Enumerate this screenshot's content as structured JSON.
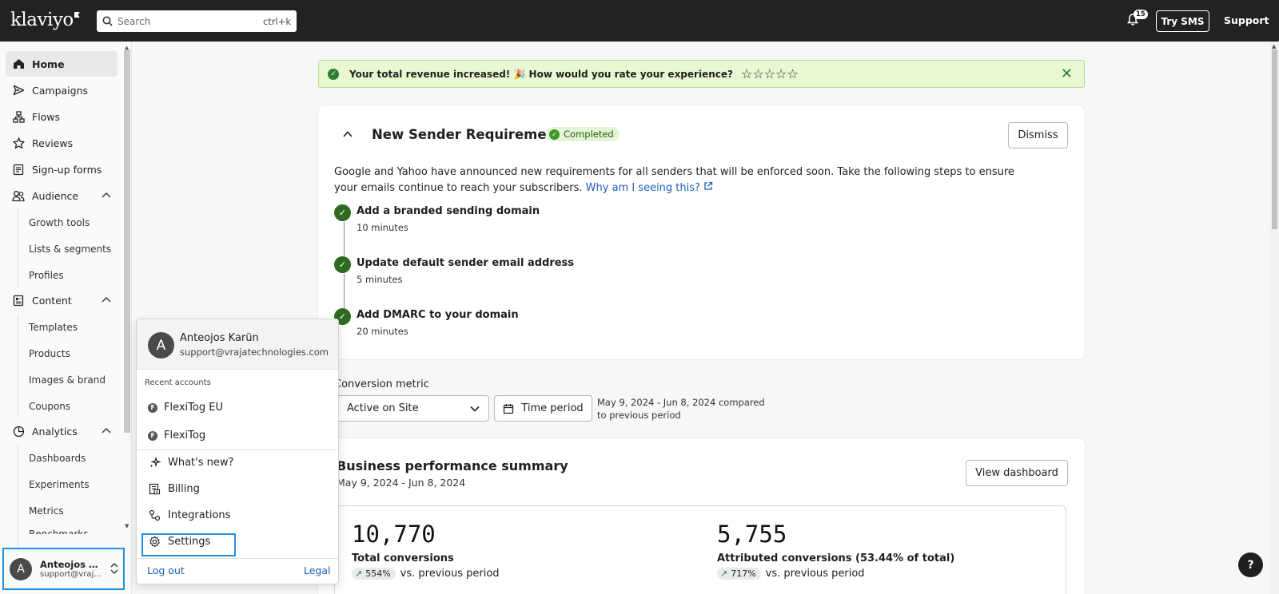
{
  "topbar": {
    "logo": "klaviyo",
    "search_placeholder": "Search",
    "search_shortcut": "ctrl+k",
    "notifications_count": "15",
    "try_sms": "Try SMS",
    "support": "Support"
  },
  "sidebar": {
    "items": [
      {
        "label": "Home",
        "icon": "home-icon"
      },
      {
        "label": "Campaigns",
        "icon": "send-icon"
      },
      {
        "label": "Flows",
        "icon": "flows-icon"
      },
      {
        "label": "Reviews",
        "icon": "star-icon"
      },
      {
        "label": "Sign-up forms",
        "icon": "form-icon"
      },
      {
        "label": "Audience",
        "icon": "audience-icon"
      },
      {
        "label": "Content",
        "icon": "content-icon"
      },
      {
        "label": "Analytics",
        "icon": "analytics-icon"
      }
    ],
    "audience_sub": [
      "Growth tools",
      "Lists & segments",
      "Profiles"
    ],
    "content_sub": [
      "Templates",
      "Products",
      "Images & brand",
      "Coupons"
    ],
    "analytics_sub": [
      "Dashboards",
      "Experiments",
      "Metrics",
      "Benchmarks"
    ],
    "account": {
      "initial": "A",
      "name": "Anteojos K...",
      "email": "support@vraj..."
    }
  },
  "banner": {
    "message": "Your total revenue increased! 🎉 How would you rate your experience?",
    "stars": "☆☆☆☆☆"
  },
  "sender_requirements": {
    "title": "New Sender Requirements",
    "status": "Completed",
    "dismiss": "Dismiss",
    "description": "Google and Yahoo have announced new requirements for all senders that will be enforced soon. Take the following steps to ensure your emails continue to reach your subscribers.",
    "link": "Why am I seeing this?",
    "steps": [
      {
        "title": "Add a branded sending domain",
        "time": "10 minutes"
      },
      {
        "title": "Update default sender email address",
        "time": "5 minutes"
      },
      {
        "title": "Add DMARC to your domain",
        "time": "20 minutes"
      }
    ]
  },
  "conversion": {
    "label": "Conversion metric",
    "metric_value": "Active on Site",
    "time_period": "Time period",
    "range_text": "May 9, 2024 - Jun 8, 2024 compared to previous period"
  },
  "summary": {
    "title": "Business performance summary",
    "subtitle": "May 9, 2024 - Jun 8, 2024",
    "view_dashboard": "View dashboard",
    "metrics": [
      {
        "value": "10,770",
        "label": "Total conversions",
        "change": "554%",
        "suffix": "vs. previous period"
      },
      {
        "value": "5,755",
        "label": "Attributed conversions (53.44% of total)",
        "change": "717%",
        "suffix": "vs. previous period"
      }
    ]
  },
  "help": "?",
  "account_menu": {
    "initial": "A",
    "name": "Anteojos Karün",
    "email": "support@vrajatechnologies.com",
    "recent_label": "Recent accounts",
    "recent": [
      {
        "initial": "F",
        "name": "FlexiTog EU"
      },
      {
        "initial": "F",
        "name": "FlexiTog"
      }
    ],
    "items": [
      {
        "label": "What's new?",
        "icon": "sparkle-icon"
      },
      {
        "label": "Billing",
        "icon": "billing-icon"
      },
      {
        "label": "Integrations",
        "icon": "integrations-icon"
      },
      {
        "label": "Settings",
        "icon": "gear-icon"
      }
    ],
    "logout": "Log out",
    "legal": "Legal"
  }
}
